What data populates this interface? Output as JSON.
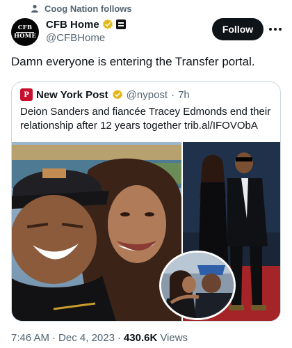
{
  "social_context": {
    "text": "Coog Nation follows",
    "icon": "person-icon"
  },
  "author": {
    "avatar_lines": [
      "CFB",
      "HOME"
    ],
    "display_name": "CFB Home",
    "handle": "@CFBHome",
    "verified_color": "#e2b719"
  },
  "actions": {
    "follow_label": "Follow",
    "more_icon": "more-dots-icon"
  },
  "tweet": {
    "text": "Damn everyone is entering the Transfer portal."
  },
  "quote": {
    "avatar_letter": "P",
    "name": "New York Post",
    "handle": "@nypost",
    "separator": "·",
    "time": "7h",
    "text": "Deion Sanders and fiancée Tracey Edmonds end their relationship after 12 years together trib.al/IFOVObA"
  },
  "meta": {
    "time": "7:46 AM",
    "separator": "·",
    "date": "Dec 4, 2023",
    "dot2": "·",
    "views_count": "430.6K",
    "views_label": "Views"
  },
  "colors": {
    "text": "#0f1419",
    "secondary": "#536471",
    "border": "#cfd9de",
    "nypost_red": "#c8102e"
  }
}
